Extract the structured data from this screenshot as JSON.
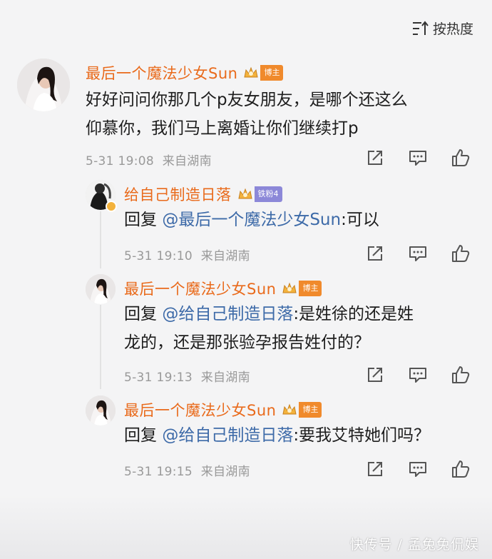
{
  "sort": {
    "label": "按热度",
    "icon": "sort-icon"
  },
  "main_comment": {
    "username": "最后一个魔法少女Sun",
    "badge": "博主",
    "text_line1": "好好问问你那几个p友女朋友，是哪个还这么",
    "text_line2": "仰慕你，我们马上离婚让你们继续打p",
    "time": "5-31 19:08",
    "location": "来自湖南"
  },
  "replies": [
    {
      "username": "给自己制造日落",
      "badge": "铁粉4",
      "prefix": "回复 ",
      "mention": "@最后一个魔法少女Sun",
      "text": ":可以",
      "time": "5-31 19:10",
      "location": "来自湖南"
    },
    {
      "username": "最后一个魔法少女Sun",
      "badge": "博主",
      "prefix": "回复 ",
      "mention": "@给自己制造日落",
      "text": ":是姓徐的还是姓",
      "text_line2": "龙的，还是那张验孕报告姓付的？",
      "time": "5-31 19:13",
      "location": "来自湖南"
    },
    {
      "username": "最后一个魔法少女Sun",
      "badge": "博主",
      "prefix": "回复 ",
      "mention": "@给自己制造日落",
      "text": ":要我艾特她们吗？",
      "time": "5-31 19:15",
      "location": "来自湖南"
    }
  ],
  "watermark": "快传号 / 孟兔兔侃娱",
  "colors": {
    "username": "#e96a1b",
    "mention": "#3d6aa8",
    "meta": "#999999",
    "badge_blogger": "#f08a2c",
    "badge_fan": "#f3b23c"
  }
}
